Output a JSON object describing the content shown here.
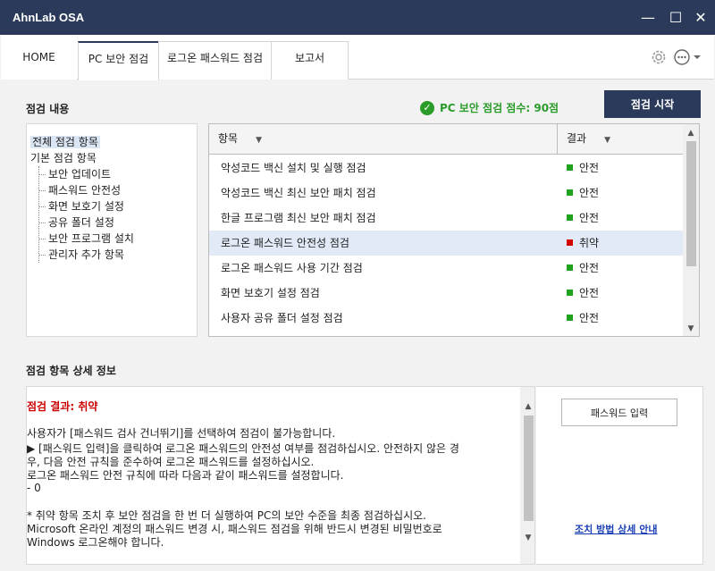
{
  "window": {
    "title": "AhnLab OSA",
    "minimize": "—",
    "maximize": "☐",
    "close": "✕"
  },
  "tabs": [
    {
      "label": "HOME"
    },
    {
      "label": "PC 보안 점검"
    },
    {
      "label": "로그온 패스워드 점검"
    },
    {
      "label": "보고서"
    }
  ],
  "toolbar_icons": [
    "gear-icon",
    "more-icon"
  ],
  "inspection": {
    "section_label": "점검 내용",
    "score_text": "PC 보안 점검 점수: 90점",
    "start_button": "점검 시작"
  },
  "tree": {
    "root": "전체 점검 항목",
    "group": "기본 점검 항목",
    "children": [
      "보안 업데이트",
      "패스워드 안전성",
      "화면 보호기 설정",
      "공유 폴더 설정",
      "보안 프로그램 설치",
      "관리자 추가 항목"
    ]
  },
  "grid": {
    "columns": [
      "항목",
      "결과"
    ],
    "rows": [
      {
        "item": "악성코드 백신 설치 및 실행 점검",
        "result": "안전",
        "status": "safe"
      },
      {
        "item": "악성코드 백신 최신 보안 패치 점검",
        "result": "안전",
        "status": "safe"
      },
      {
        "item": "한글 프로그램 최신 보안 패치 점검",
        "result": "안전",
        "status": "safe"
      },
      {
        "item": "로그온 패스워드 안전성 점검",
        "result": "취약",
        "status": "vulnerable"
      },
      {
        "item": "로그온 패스워드 사용 기간 점검",
        "result": "안전",
        "status": "safe"
      },
      {
        "item": "화면 보호기 설정 점검",
        "result": "안전",
        "status": "safe"
      },
      {
        "item": "사용자 공유 폴더 설정 점검",
        "result": "안전",
        "status": "safe"
      }
    ],
    "selected_row": 3
  },
  "detail": {
    "section_label": "점검 항목 상세 정보",
    "result": "점검 결과: 취약",
    "lines": [
      " 사용자가 [패스워드 검사 건너뛰기]를 선택하여 점검이 불가능합니다.",
      "   ▶ [패스워드 입력]을 클릭하여 로그온 패스워드의 안전성 여부를 점검하십시오. 안전하지 않은 경",
      "우, 다음 안전 규칙을 준수하여 로그온 패스워드를 설정하십시오.",
      "    로그온 패스워드 안전 규칙에 따라 다음과 같이 패스워드를 설정합니다.",
      "    - 0",
      "",
      "  * 취약 항목 조치 후 보안 점검을 한 번 더 실행하여 PC의 보안 수준을 최종 점검하십시오.",
      "  Microsoft 온라인 계정의 패스워드 변경 시, 패스워드 점검을 위해 반드시 변경된 비밀번호로",
      " Windows 로그온해야 합니다."
    ],
    "password_button": "패스워드 입력",
    "guide_link": "조치 방법 상세 안내"
  },
  "colors": {
    "safe": "#1fa31f",
    "vulnerable": "#d40000",
    "accent": "#2b3a5a"
  }
}
